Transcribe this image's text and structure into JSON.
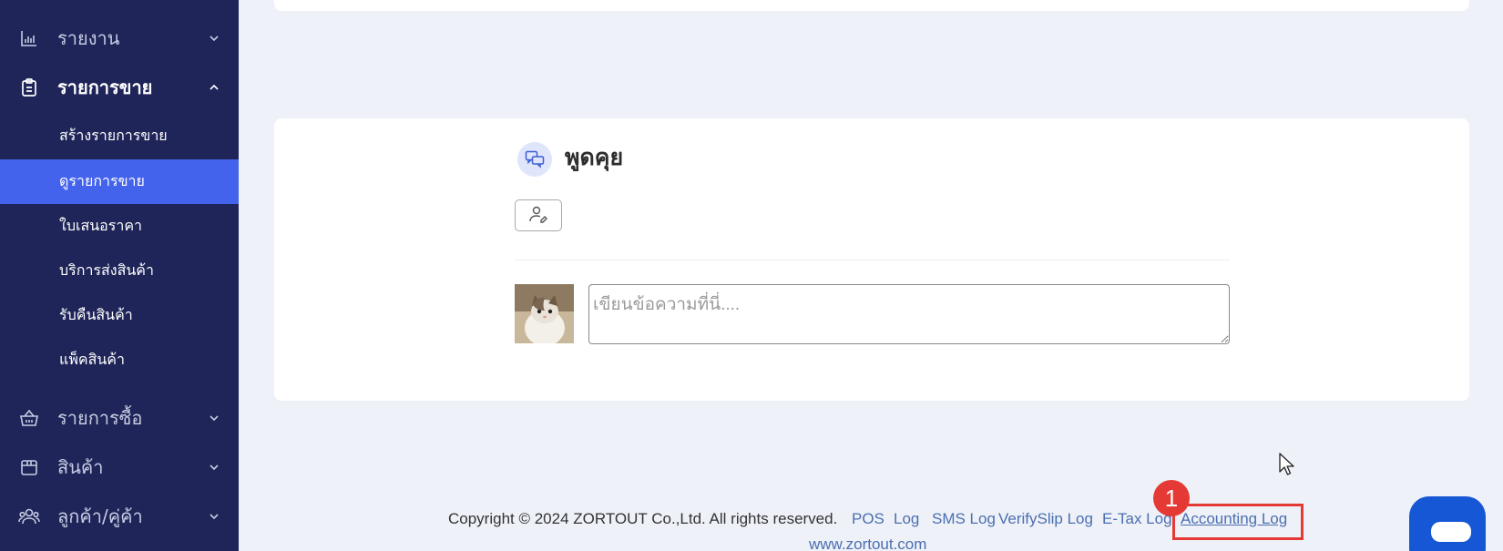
{
  "sidebar": {
    "report": {
      "label": "รายงาน"
    },
    "sales": {
      "label": "รายการขาย"
    },
    "sales_items": [
      {
        "label": "สร้างรายการขาย"
      },
      {
        "label": "ดูรายการขาย"
      },
      {
        "label": "ใบเสนอราคา"
      },
      {
        "label": "บริการส่งสินค้า"
      },
      {
        "label": "รับคืนสินค้า"
      },
      {
        "label": "แพ็คสินค้า"
      }
    ],
    "purchase": {
      "label": "รายการซื้อ"
    },
    "products": {
      "label": "สินค้า"
    },
    "contacts": {
      "label": "ลูกค้า/คู่ค้า"
    }
  },
  "chat": {
    "title": "พูดคุย",
    "placeholder": "เขียนข้อความที่นี่...."
  },
  "footer": {
    "copyright": "Copyright © 2024 ZORTOUT Co.,Ltd. All rights reserved.",
    "links": [
      "POS",
      "Log",
      "SMS Log",
      "VerifySlip Log",
      "E-Tax Log",
      "Accounting Log"
    ],
    "site": "www.zortout.com"
  },
  "annotation": {
    "step": "1"
  },
  "colors": {
    "sidebar_bg": "#1f2558",
    "selected_bg": "#4463ec",
    "highlight_red": "#e53935",
    "fab_blue": "#1657d6"
  }
}
